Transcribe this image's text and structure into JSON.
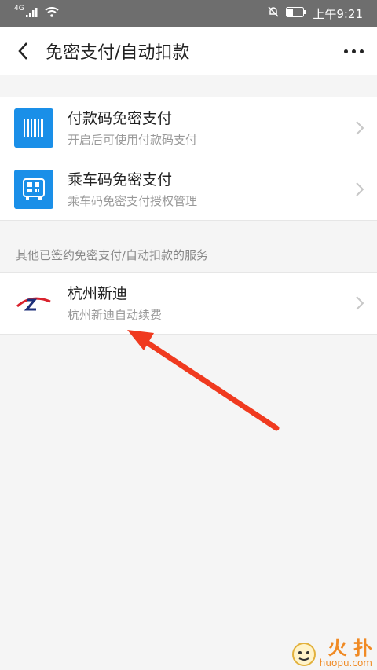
{
  "status_bar": {
    "network": "4G",
    "time": "上午9:21"
  },
  "nav": {
    "title": "免密支付/自动扣款"
  },
  "items": [
    {
      "title": "付款码免密支付",
      "subtitle": "开启后可使用付款码支付",
      "icon": "barcode-icon",
      "icon_color": "#1a8fe8"
    },
    {
      "title": "乘车码免密支付",
      "subtitle": "乘车码免密支付授权管理",
      "icon": "bus-qrcode-icon",
      "icon_color": "#1a8fe8"
    }
  ],
  "section_label": "其他已签约免密支付/自动扣款的服务",
  "services": [
    {
      "title": "杭州新迪",
      "subtitle": "杭州新迪自动续费",
      "icon": "hangzhou-xindi-logo"
    }
  ],
  "watermark": {
    "big": "火 扑",
    "small": "huopu.com"
  },
  "annotation": {
    "arrow_color": "#f03a1f"
  }
}
